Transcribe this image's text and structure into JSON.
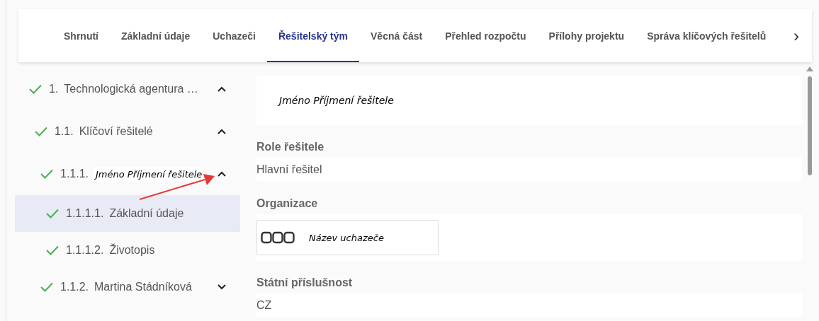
{
  "tabs": [
    {
      "label": "Shrnutí",
      "selected": false
    },
    {
      "label": "Základní údaje",
      "selected": false
    },
    {
      "label": "Uchazeči",
      "selected": false
    },
    {
      "label": "Řešitelský tým",
      "selected": true
    },
    {
      "label": "Věcná část",
      "selected": false
    },
    {
      "label": "Přehled rozpočtu",
      "selected": false
    },
    {
      "label": "Přílohy projektu",
      "selected": false
    },
    {
      "label": "Správa klíčových řešitelů",
      "selected": false
    }
  ],
  "tabs_next": "›",
  "tree": [
    {
      "number": "1.",
      "label": "Technologická agentura …",
      "kind": "plain",
      "checked": true,
      "expanded": true,
      "selected": false,
      "children": [
        {
          "number": "1.1.",
          "label": "Klíčoví řešitelé",
          "kind": "plain",
          "checked": true,
          "expanded": true,
          "selected": false,
          "children": [
            {
              "number": "1.1.1.",
              "label": "Jméno Příjmení řešitele",
              "kind": "placeholder",
              "checked": true,
              "expanded": true,
              "selected": false,
              "children": [
                {
                  "number": "1.1.1.1.",
                  "label": "Základní údaje",
                  "kind": "plain",
                  "checked": true,
                  "selected": true
                },
                {
                  "number": "1.1.1.2.",
                  "label": "Životopis",
                  "kind": "plain",
                  "checked": true,
                  "selected": false
                }
              ]
            },
            {
              "number": "1.1.2.",
              "label": "Martina Stádníková",
              "kind": "plain",
              "checked": true,
              "expanded": false,
              "selected": false
            }
          ]
        }
      ]
    }
  ],
  "header": {
    "name": "Jméno Příjmení řešitele"
  },
  "fields": [
    {
      "label": "Role řešitele",
      "kind": "text",
      "value": "Hlavní řešitel"
    },
    {
      "label": "Organizace",
      "kind": "organization",
      "value": "Název uchazeče"
    },
    {
      "label": "Státní příslušnost",
      "kind": "text",
      "value": "CZ"
    }
  ]
}
